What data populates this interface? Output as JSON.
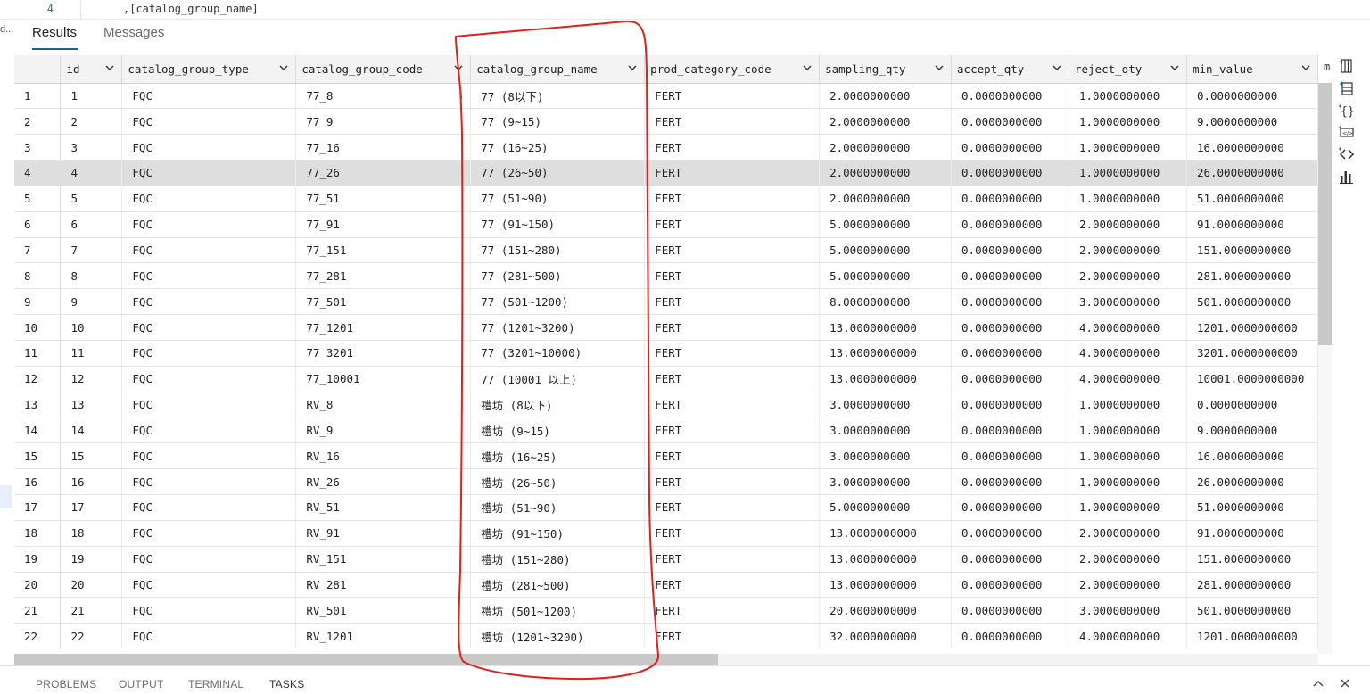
{
  "editor": {
    "line_number": "4",
    "code_line": ",[catalog_group_name]",
    "left_edge_text": "d..."
  },
  "tabs": {
    "results": "Results",
    "messages": "Messages"
  },
  "grid": {
    "headers": [
      "",
      "id",
      "catalog_group_type",
      "catalog_group_code",
      "catalog_group_name",
      "prod_category_code",
      "sampling_qty",
      "accept_qty",
      "reject_qty",
      "min_value"
    ],
    "more_column": "m",
    "selected_row": 4,
    "rows": [
      [
        "1",
        "1",
        "FQC",
        "77_8",
        "77 (8以下)",
        "FERT",
        "2.0000000000",
        "0.0000000000",
        "1.0000000000",
        "0.0000000000"
      ],
      [
        "2",
        "2",
        "FQC",
        "77_9",
        "77 (9~15)",
        "FERT",
        "2.0000000000",
        "0.0000000000",
        "1.0000000000",
        "9.0000000000"
      ],
      [
        "3",
        "3",
        "FQC",
        "77_16",
        "77 (16~25)",
        "FERT",
        "2.0000000000",
        "0.0000000000",
        "1.0000000000",
        "16.0000000000"
      ],
      [
        "4",
        "4",
        "FQC",
        "77_26",
        "77 (26~50)",
        "FERT",
        "2.0000000000",
        "0.0000000000",
        "1.0000000000",
        "26.0000000000"
      ],
      [
        "5",
        "5",
        "FQC",
        "77_51",
        "77 (51~90)",
        "FERT",
        "2.0000000000",
        "0.0000000000",
        "1.0000000000",
        "51.0000000000"
      ],
      [
        "6",
        "6",
        "FQC",
        "77_91",
        "77 (91~150)",
        "FERT",
        "5.0000000000",
        "0.0000000000",
        "2.0000000000",
        "91.0000000000"
      ],
      [
        "7",
        "7",
        "FQC",
        "77_151",
        "77 (151~280)",
        "FERT",
        "5.0000000000",
        "0.0000000000",
        "2.0000000000",
        "151.0000000000"
      ],
      [
        "8",
        "8",
        "FQC",
        "77_281",
        "77 (281~500)",
        "FERT",
        "5.0000000000",
        "0.0000000000",
        "2.0000000000",
        "281.0000000000"
      ],
      [
        "9",
        "9",
        "FQC",
        "77_501",
        "77 (501~1200)",
        "FERT",
        "8.0000000000",
        "0.0000000000",
        "3.0000000000",
        "501.0000000000"
      ],
      [
        "10",
        "10",
        "FQC",
        "77_1201",
        "77 (1201~3200)",
        "FERT",
        "13.0000000000",
        "0.0000000000",
        "4.0000000000",
        "1201.0000000000"
      ],
      [
        "11",
        "11",
        "FQC",
        "77_3201",
        "77 (3201~10000)",
        "FERT",
        "13.0000000000",
        "0.0000000000",
        "4.0000000000",
        "3201.0000000000"
      ],
      [
        "12",
        "12",
        "FQC",
        "77_10001",
        "77 (10001 以上)",
        "FERT",
        "13.0000000000",
        "0.0000000000",
        "4.0000000000",
        "10001.0000000000"
      ],
      [
        "13",
        "13",
        "FQC",
        "RV_8",
        "禮坊 (8以下)",
        "FERT",
        "3.0000000000",
        "0.0000000000",
        "1.0000000000",
        "0.0000000000"
      ],
      [
        "14",
        "14",
        "FQC",
        "RV_9",
        "禮坊 (9~15)",
        "FERT",
        "3.0000000000",
        "0.0000000000",
        "1.0000000000",
        "9.0000000000"
      ],
      [
        "15",
        "15",
        "FQC",
        "RV_16",
        "禮坊 (16~25)",
        "FERT",
        "3.0000000000",
        "0.0000000000",
        "1.0000000000",
        "16.0000000000"
      ],
      [
        "16",
        "16",
        "FQC",
        "RV_26",
        "禮坊 (26~50)",
        "FERT",
        "3.0000000000",
        "0.0000000000",
        "1.0000000000",
        "26.0000000000"
      ],
      [
        "17",
        "17",
        "FQC",
        "RV_51",
        "禮坊 (51~90)",
        "FERT",
        "5.0000000000",
        "0.0000000000",
        "1.0000000000",
        "51.0000000000"
      ],
      [
        "18",
        "18",
        "FQC",
        "RV_91",
        "禮坊 (91~150)",
        "FERT",
        "13.0000000000",
        "0.0000000000",
        "2.0000000000",
        "91.0000000000"
      ],
      [
        "19",
        "19",
        "FQC",
        "RV_151",
        "禮坊 (151~280)",
        "FERT",
        "13.0000000000",
        "0.0000000000",
        "2.0000000000",
        "151.0000000000"
      ],
      [
        "20",
        "20",
        "FQC",
        "RV_281",
        "禮坊 (281~500)",
        "FERT",
        "13.0000000000",
        "0.0000000000",
        "2.0000000000",
        "281.0000000000"
      ],
      [
        "21",
        "21",
        "FQC",
        "RV_501",
        "禮坊 (501~1200)",
        "FERT",
        "20.0000000000",
        "0.0000000000",
        "3.0000000000",
        "501.0000000000"
      ],
      [
        "22",
        "22",
        "FQC",
        "RV_1201",
        "禮坊 (1201~3200)",
        "FERT",
        "32.0000000000",
        "0.0000000000",
        "4.0000000000",
        "1201.0000000000"
      ]
    ]
  },
  "toolbar": [
    "export-csv-icon",
    "export-excel-icon",
    "export-json-icon",
    "export-xml-icon",
    "view-code-icon",
    "chart-icon"
  ],
  "panel": {
    "tabs": [
      "PROBLEMS",
      "OUTPUT",
      "TERMINAL",
      "TASKS"
    ],
    "active_tab": "TASKS"
  },
  "annotation_color": "#e0201b"
}
